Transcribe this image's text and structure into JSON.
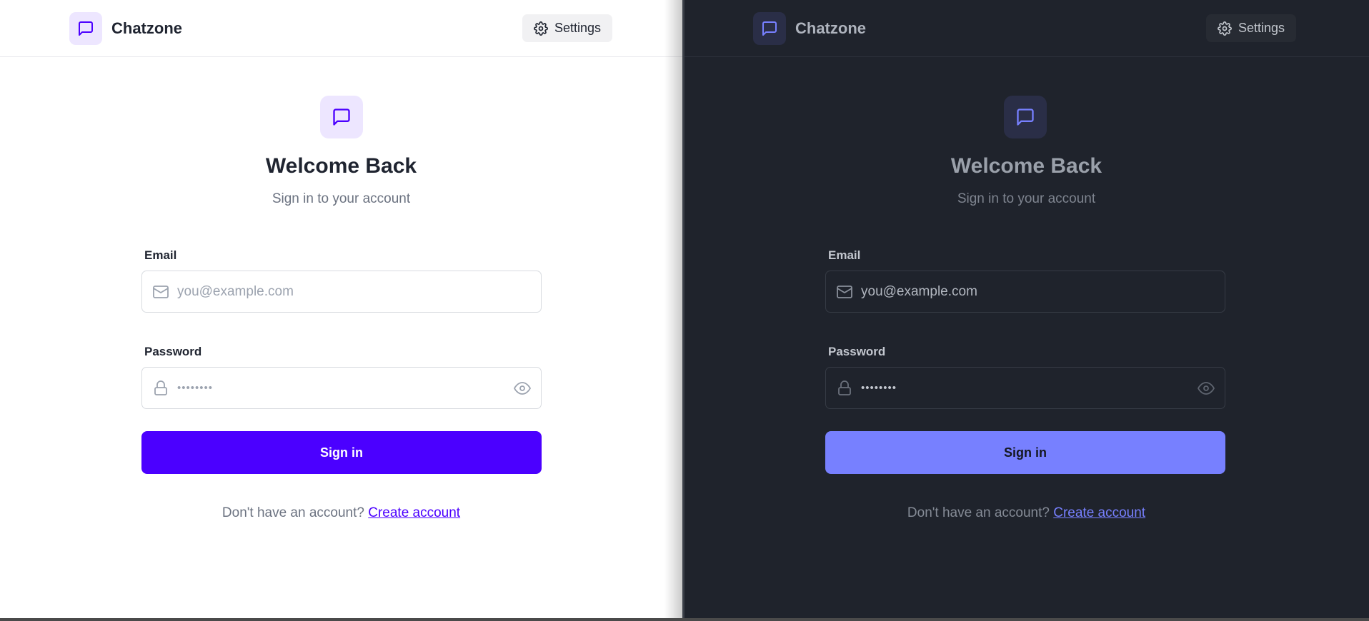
{
  "app": {
    "name": "Chatzone"
  },
  "header": {
    "settings_label": "Settings"
  },
  "login": {
    "title": "Welcome Back",
    "subtitle": "Sign in to your account",
    "email_label": "Email",
    "email_placeholder": "you@example.com",
    "password_label": "Password",
    "password_mask": "••••••••",
    "submit_label": "Sign in",
    "no_account_text": "Don't have an account?",
    "create_account_link": "Create account"
  },
  "themes": {
    "light": {
      "accent": "#4b00ff",
      "background": "#ffffff"
    },
    "dark": {
      "accent": "#7780ff",
      "background": "#1f232c"
    }
  },
  "icons": [
    "message-square-icon",
    "gear-icon",
    "mail-icon",
    "lock-icon",
    "eye-icon"
  ]
}
